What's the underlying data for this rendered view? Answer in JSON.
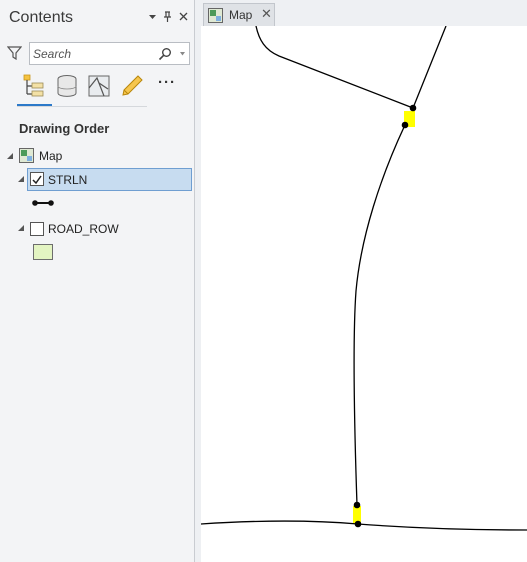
{
  "contents_pane": {
    "title": "Contents",
    "header_buttons": {
      "options": "▾",
      "pin": "Ұ",
      "close": "✕"
    },
    "search": {
      "placeholder": "Search",
      "value": ""
    },
    "toolbar_icons": [
      "list-by-drawing-order-icon",
      "list-by-data-source-icon",
      "list-by-selection-icon",
      "list-by-editing-icon"
    ],
    "more_label": "···",
    "section_title": "Drawing Order",
    "tree": {
      "map": {
        "label": "Map"
      },
      "layers": [
        {
          "label": "STRLN",
          "checked": true,
          "selected": true,
          "symbol": "line-symbol-icon"
        },
        {
          "label": "ROAD_ROW",
          "checked": false,
          "selected": false,
          "symbol": "polygon-symbol-icon",
          "fill": "#e3f4c2"
        }
      ]
    }
  },
  "map_view": {
    "tab_label": "Map",
    "tab_close": "✕",
    "highlight_color": "#ffff00",
    "line_color": "#000000"
  }
}
